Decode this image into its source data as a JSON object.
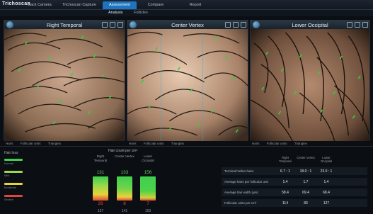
{
  "app": {
    "logo": "Trichoscan"
  },
  "tabs": [
    {
      "label": "Back Camera",
      "active": false
    },
    {
      "label": "Trichoscan Capture",
      "active": false
    },
    {
      "label": "Assessment",
      "active": true
    },
    {
      "label": "Compare",
      "active": false
    },
    {
      "label": "Report",
      "active": false
    }
  ],
  "subtabs": [
    {
      "label": "Analysis",
      "active": true
    },
    {
      "label": "Follicles",
      "active": false
    }
  ],
  "panels": [
    {
      "title": "Right Temporal"
    },
    {
      "title": "Center Vertex"
    },
    {
      "title": "Lower Occipital"
    }
  ],
  "tools": {
    "hairs": "Hairs",
    "follicles": "Follicular units",
    "triangles": "Triangles"
  },
  "legend": {
    "title": "Hair loss",
    "items": [
      {
        "color": "#3fcf4f",
        "text": "Normal"
      },
      {
        "color": "#9bd84a",
        "text": "Mild"
      },
      {
        "color": "#e8d23a",
        "text": "Moderate"
      },
      {
        "color": "#e2463a",
        "text": "Severe"
      }
    ]
  },
  "chart": {
    "title": "Hair count per cm²",
    "columns": [
      {
        "header": "Right Temporal",
        "top": "131",
        "bottom": "26",
        "extra": "157"
      },
      {
        "header": "Center Vertex",
        "top": "133",
        "bottom": "8",
        "extra": "141"
      },
      {
        "header": "Lower Occipital",
        "top": "156",
        "bottom": "7",
        "extra": "163"
      }
    ]
  },
  "stats": {
    "headers": [
      "Right Temporal",
      "Center Vertex",
      "Lower Occipital"
    ],
    "rows": [
      {
        "label": "Terminal:Vellus hairs",
        "values": [
          "6.7 : 1",
          "18.0 : 1",
          "23.0 : 1"
        ]
      },
      {
        "label": "Average hairs per follicular unit",
        "values": [
          "1.4",
          "1.7",
          "1.4"
        ]
      },
      {
        "label": "Average hair width (μm)",
        "values": [
          "58.4",
          "69.4",
          "68.4"
        ]
      },
      {
        "label": "Follicular units per cm²",
        "values": [
          "114",
          "83",
          "127"
        ]
      }
    ]
  },
  "colors": {
    "accent": "#1d74c0",
    "good": "#3fcf4f",
    "warn": "#e8d23a",
    "bad": "#e2463a"
  }
}
